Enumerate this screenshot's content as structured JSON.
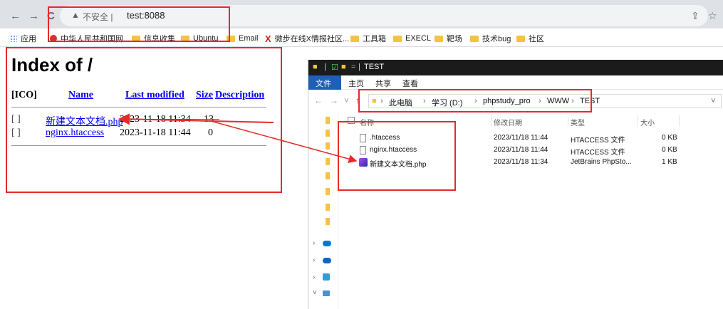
{
  "browser": {
    "back": "←",
    "forward": "→",
    "reload": "C",
    "security_label": "不安全",
    "separator": "|",
    "url": "test:8088",
    "share_icon": "⇪",
    "star_icon": "☆"
  },
  "bookmarks": [
    {
      "label": "应用",
      "icon": "apps-grid"
    },
    {
      "label": "中华人民共和国网...",
      "icon": "red-dot"
    },
    {
      "label": "信息收集",
      "icon": "folder"
    },
    {
      "label": "Ubuntu",
      "icon": "folder"
    },
    {
      "label": "Email",
      "icon": "folder"
    },
    {
      "label": "微步在线X情报社区...",
      "icon": "x-logo"
    },
    {
      "label": "工具箱",
      "icon": "folder"
    },
    {
      "label": "EXECL",
      "icon": "folder"
    },
    {
      "label": "靶场",
      "icon": "folder"
    },
    {
      "label": "技术bug",
      "icon": "folder"
    },
    {
      "label": "社区",
      "icon": "folder"
    }
  ],
  "index": {
    "title": "Index of /",
    "headers": {
      "ico": "[ICO]",
      "name": "Name",
      "modified": "Last modified",
      "size": "Size",
      "description": "Description"
    },
    "rows": [
      {
        "icon": "[ ]",
        "name": "新建文本文档.php",
        "modified": "2023-11-18 11:34",
        "size": "13"
      },
      {
        "icon": "[ ]",
        "name": "nginx.htaccess",
        "modified": "2023-11-18 11:44",
        "size": "0"
      }
    ]
  },
  "explorer": {
    "title": "TEST",
    "title_sep": "|",
    "ribbon": [
      "文件",
      "主页",
      "共享",
      "查看"
    ],
    "breadcrumb": [
      "此电脑",
      "学习 (D:)",
      "phpstudy_pro",
      "WWW",
      "TEST"
    ],
    "crumb_sep": "›",
    "columns": {
      "name": "名称",
      "modified": "修改日期",
      "type": "类型",
      "size": "大小"
    },
    "files": [
      {
        "name": ".htaccess",
        "modified": "2023/11/18 11:44",
        "type": "HTACCESS 文件",
        "size": "0 KB",
        "icon": "document"
      },
      {
        "name": "nginx.htaccess",
        "modified": "2023/11/18 11:44",
        "type": "HTACCESS 文件",
        "size": "0 KB",
        "icon": "document"
      },
      {
        "name": "新建文本文档.php",
        "modified": "2023/11/18 11:34",
        "type": "JetBrains PhpSto...",
        "size": "1 KB",
        "icon": "phpstorm"
      }
    ]
  },
  "colors": {
    "annotation": "#e52a2a",
    "link": "#0000ee",
    "explorer_file_tab": "#1f5fb7"
  }
}
